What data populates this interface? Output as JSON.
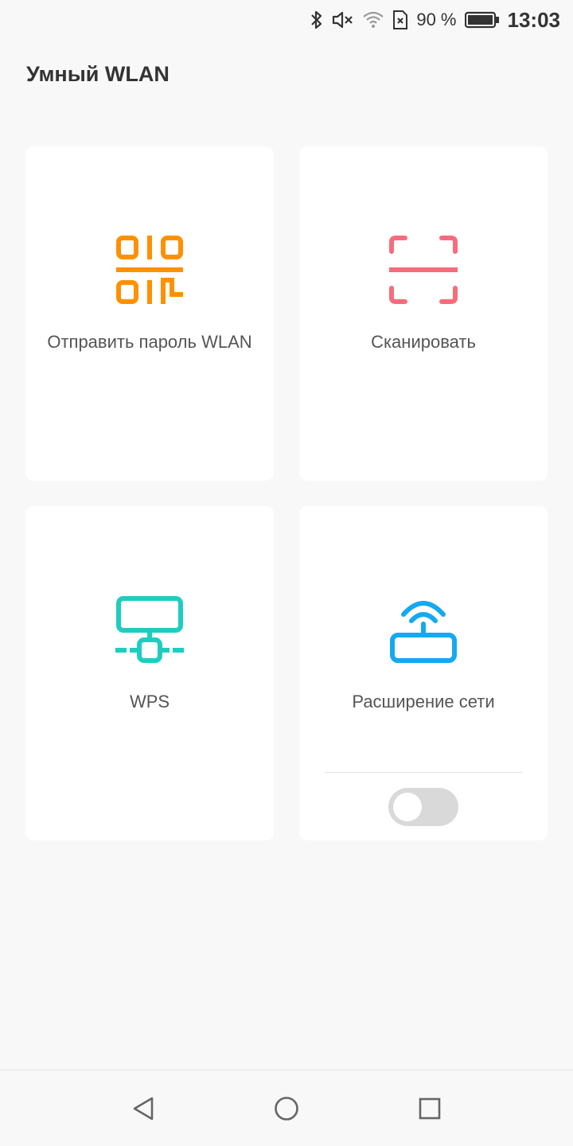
{
  "status_bar": {
    "battery_percent": "90 %",
    "time": "13:03",
    "icons": [
      "bluetooth-icon",
      "mute-icon",
      "wifi-icon",
      "no-sim-icon",
      "battery-icon"
    ]
  },
  "page": {
    "title": "Умный WLAN"
  },
  "cards": {
    "send_password": {
      "label": "Отправить пароль WLAN",
      "icon": "qr-code-icon",
      "color": "#ff9000"
    },
    "scan": {
      "label": "Сканировать",
      "icon": "scan-frame-icon",
      "color": "#f76c7c"
    },
    "wps": {
      "label": "WPS",
      "icon": "wps-network-icon",
      "color": "#1fcdc0"
    },
    "extension": {
      "label": "Расширение сети",
      "icon": "router-icon",
      "color": "#14a9f0",
      "toggle_on": false
    }
  },
  "nav_bar": {
    "buttons": [
      "back-icon",
      "home-icon",
      "recent-apps-icon"
    ]
  }
}
